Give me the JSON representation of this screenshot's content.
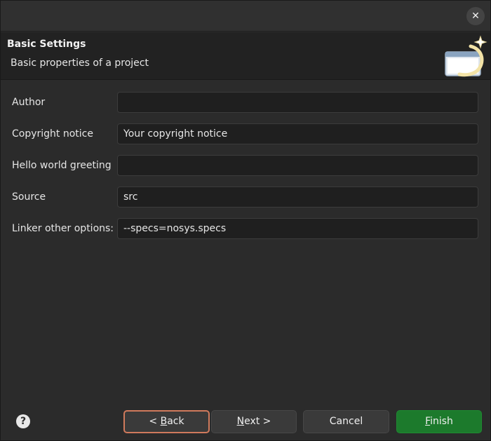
{
  "window": {
    "close_glyph": "✕"
  },
  "header": {
    "title": "Basic Settings",
    "description": "Basic properties of a project"
  },
  "form": {
    "fields": [
      {
        "label": "Author",
        "value": ""
      },
      {
        "label": "Copyright notice",
        "value": "Your copyright notice"
      },
      {
        "label": "Hello world greeting",
        "value": ""
      },
      {
        "label": "Source",
        "value": "src"
      },
      {
        "label": "Linker other options:",
        "value": "--specs=nosys.specs"
      }
    ]
  },
  "footer": {
    "help_glyph": "?",
    "back": {
      "prefix": "< ",
      "mnemonic": "B",
      "rest": "ack"
    },
    "next": {
      "prefix": "",
      "mnemonic": "N",
      "rest": "ext >"
    },
    "cancel": {
      "label": "Cancel"
    },
    "finish": {
      "prefix": "",
      "mnemonic": "F",
      "rest": "inish"
    }
  },
  "colors": {
    "finish_button": "#1c7a2c",
    "back_button_border": "#d07a5c",
    "background": "#2b2b2b"
  },
  "icons": {
    "close": "close-icon",
    "help": "help-icon",
    "wizard": "wizard-banner-icon"
  }
}
